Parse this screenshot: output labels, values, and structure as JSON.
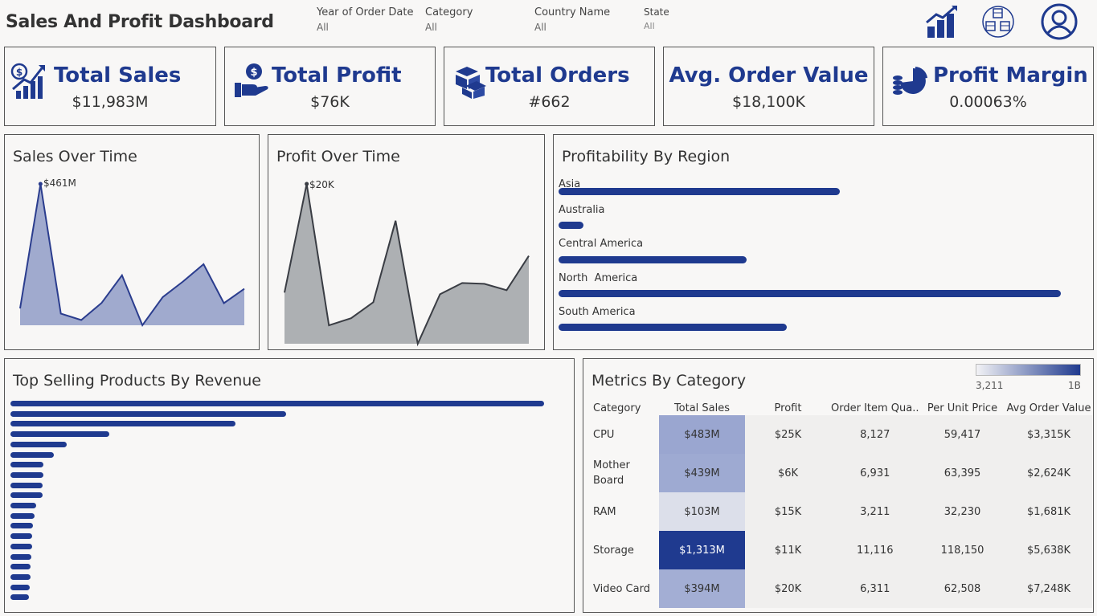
{
  "header": {
    "title": "Sales And Profit Dashboard",
    "filters": [
      {
        "label": "Year of Order Date",
        "value": "All"
      },
      {
        "label": "Category",
        "value": "All"
      },
      {
        "label": "Country Name",
        "value": "All"
      },
      {
        "label": "State",
        "value": "All"
      }
    ],
    "icons": [
      "bar-chart-icon",
      "boxes-network-icon",
      "user-icon"
    ]
  },
  "kpis": [
    {
      "title": "Total Sales",
      "value": "$11,983M",
      "icon": "sales-growth-icon"
    },
    {
      "title": "Total Profit",
      "value": "$76K",
      "icon": "money-hand-icon"
    },
    {
      "title": "Total Orders",
      "value": "#662",
      "icon": "boxes-icon"
    },
    {
      "title": "Avg. Order Value",
      "value": "$18,100K",
      "icon": ""
    },
    {
      "title": "Profit Margin",
      "value": "0.00063%",
      "icon": "pie-coins-icon"
    }
  ],
  "sales_over_time": {
    "title": "Sales Over Time",
    "peak_label": "$461M"
  },
  "profit_over_time": {
    "title": "Profit Over Time",
    "peak_label": "$20K"
  },
  "region": {
    "title": "Profitability By Region"
  },
  "top_products": {
    "title": "Top Selling Products By Revenue"
  },
  "metrics": {
    "title": "Metrics By Category",
    "legend_min": "3,211",
    "legend_max": "1B",
    "columns": [
      "Category",
      "Total Sales",
      "Profit",
      "Order Item Qua..",
      "Per Unit Price",
      "Avg Order Value"
    ],
    "rows": [
      {
        "category": "CPU",
        "total_sales": "$483M",
        "profit": "$25K",
        "qty": "8,127",
        "unit_price": "59,417",
        "avg_order": "$3,315K",
        "shade": "#9aa6d0",
        "text_color": "#333333"
      },
      {
        "category": "Mother\nBoard",
        "total_sales": "$439M",
        "profit": "$6K",
        "qty": "6,931",
        "unit_price": "63,395",
        "avg_order": "$2,624K",
        "shade": "#9eaad2",
        "text_color": "#333333"
      },
      {
        "category": "RAM",
        "total_sales": "$103M",
        "profit": "$15K",
        "qty": "3,211",
        "unit_price": "32,230",
        "avg_order": "$1,681K",
        "shade": "#dcdfea",
        "text_color": "#333333"
      },
      {
        "category": "Storage",
        "total_sales": "$1,313M",
        "profit": "$11K",
        "qty": "11,116",
        "unit_price": "118,150",
        "avg_order": "$5,638K",
        "shade": "#1f3a8f",
        "text_color": "#ffffff"
      },
      {
        "category": "Video Card",
        "total_sales": "$394M",
        "profit": "$20K",
        "qty": "6,311",
        "unit_price": "62,508",
        "avg_order": "$7,248K",
        "shade": "#a3aed4",
        "text_color": "#333333"
      }
    ]
  },
  "chart_data": [
    {
      "type": "area",
      "title": "Sales Over Time",
      "y_unit": "$M",
      "values": [
        55,
        461,
        38,
        17,
        73,
        163,
        0,
        92,
        143,
        199,
        72,
        119
      ],
      "annotation": "$461M",
      "color": "#1f3a8f"
    },
    {
      "type": "area",
      "title": "Profit Over Time",
      "y_unit": "$K",
      "values": [
        6.4,
        20,
        2.3,
        3.2,
        5.2,
        15.4,
        0,
        6.2,
        7.6,
        7.5,
        6.7,
        11.0
      ],
      "annotation": "$20K",
      "color": "#6b6e73"
    },
    {
      "type": "bar",
      "title": "Profitability By Region",
      "orientation": "horizontal",
      "categories": [
        "Asia",
        "Australia",
        "Central America",
        "North  America",
        "South America"
      ],
      "values": [
        0.56,
        0.05,
        0.375,
        1.0,
        0.455
      ],
      "color": "#1f3a8f"
    },
    {
      "type": "bar",
      "title": "Top Selling Products By Revenue",
      "orientation": "horizontal",
      "values": [
        100,
        51.6,
        42.1,
        18.5,
        10.5,
        8.1,
        6.2,
        6.2,
        6.0,
        6.0,
        4.8,
        4.5,
        4.2,
        4.1,
        4.0,
        3.9,
        3.8,
        3.7,
        3.6,
        3.4
      ],
      "color": "#1f3a8f"
    }
  ]
}
